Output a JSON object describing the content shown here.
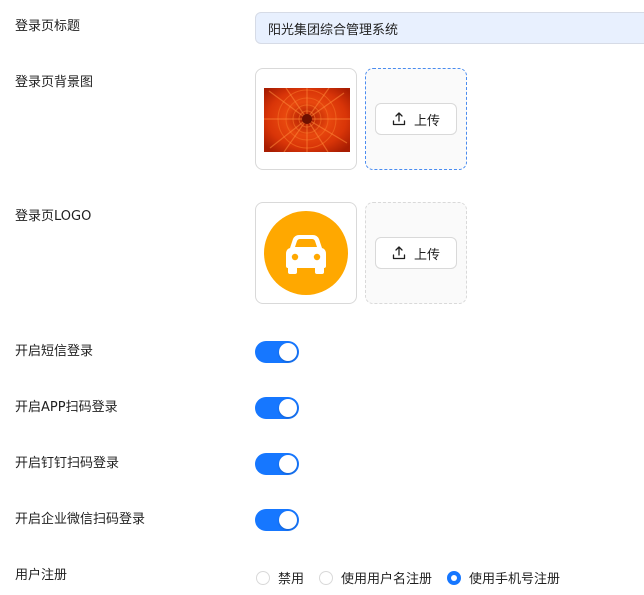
{
  "fields": {
    "login_title": {
      "label": "登录页标题",
      "value": "阳光集团综合管理系统"
    },
    "background": {
      "label": "登录页背景图",
      "upload_label": "上传"
    },
    "logo": {
      "label": "登录页LOGO",
      "upload_label": "上传"
    },
    "sms_login": {
      "label": "开启短信登录",
      "enabled": true
    },
    "app_scan_login": {
      "label": "开启APP扫码登录",
      "enabled": true
    },
    "dingtalk_scan_login": {
      "label": "开启钉钉扫码登录",
      "enabled": true
    },
    "wecom_scan_login": {
      "label": "开启企业微信扫码登录",
      "enabled": true
    },
    "user_registration": {
      "label": "用户注册",
      "options": [
        "禁用",
        "使用用户名注册",
        "使用手机号注册"
      ],
      "selected": "使用手机号注册"
    }
  },
  "colors": {
    "accent": "#1677ff",
    "logo_bg": "#ffa800",
    "input_bg": "#e8f0fe"
  },
  "icons": {
    "upload": "upload-icon",
    "logo": "car-icon"
  }
}
